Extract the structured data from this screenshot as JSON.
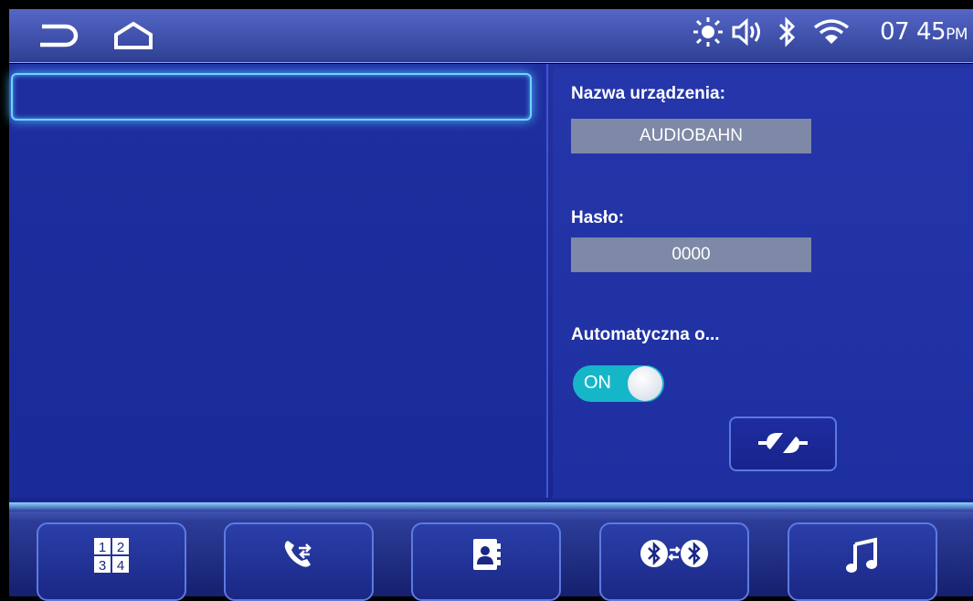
{
  "statusbar": {
    "time": "07 45",
    "ampm": "PM",
    "icons": [
      "back-icon",
      "home-icon",
      "brightness-icon",
      "volume-icon",
      "bluetooth-icon",
      "wifi-icon"
    ]
  },
  "device": {
    "search_value": "",
    "name_label": "Nazwa urządzenia:",
    "name_value": "AUDIOBAHN",
    "password_label": "Hasło:",
    "password_value": "0000",
    "auto_label": "Automatyczna o...",
    "auto_toggle": "ON"
  },
  "bottom_nav": [
    {
      "name": "dialpad",
      "icon": "dialpad-icon",
      "digits": [
        "1",
        "2",
        "3",
        "4"
      ]
    },
    {
      "name": "call-log",
      "icon": "call-transfer-icon"
    },
    {
      "name": "contacts",
      "icon": "contacts-icon"
    },
    {
      "name": "bluetooth-pairing",
      "icon": "bluetooth-pair-icon"
    },
    {
      "name": "music",
      "icon": "music-note-icon"
    }
  ],
  "colors": {
    "panel_blue": "#1f2e9e",
    "accent_cyan": "#16b6c9",
    "field_gray": "#7d89a6"
  }
}
